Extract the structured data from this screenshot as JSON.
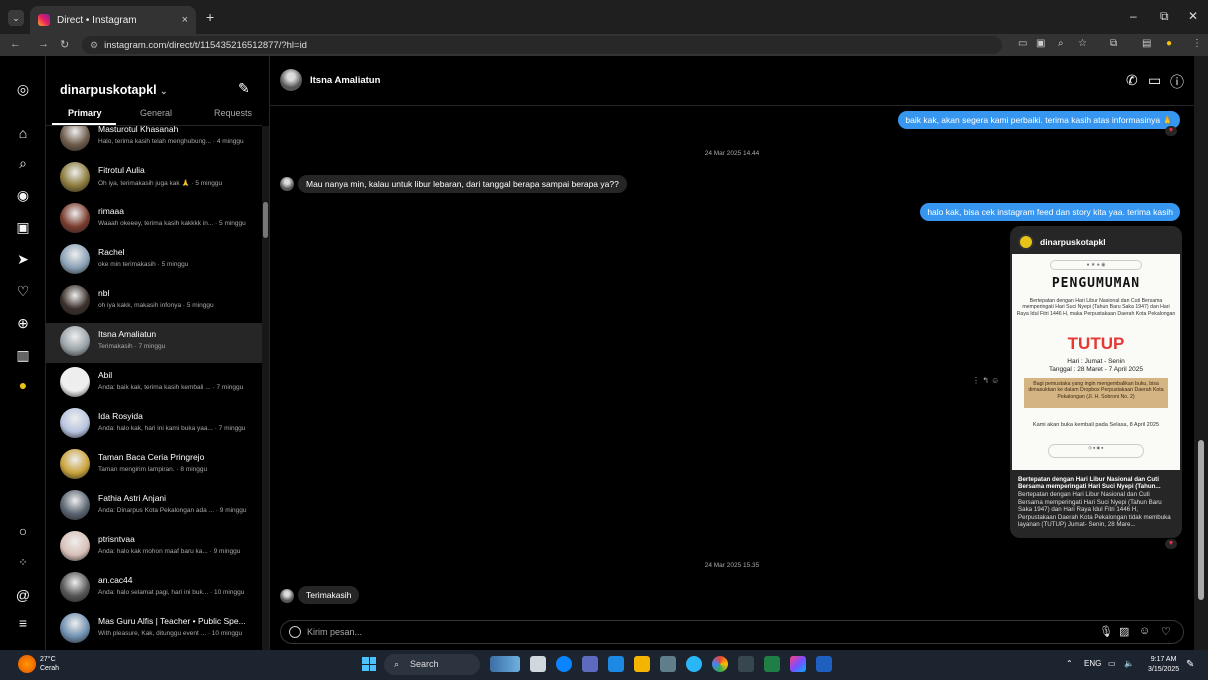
{
  "browser": {
    "tab_title": "Direct • Instagram",
    "tab_close": "×",
    "new_tab": "+",
    "url": "instagram.com/direct/t/115435216512877/?hl=id",
    "win_min": "–",
    "win_max": "⧉",
    "win_close": "✕"
  },
  "inbox": {
    "account": "dinarpuskotapkl",
    "tabs": [
      "Primary",
      "General",
      "Requests"
    ],
    "conversations": [
      {
        "name": "Masturotul Khasanah",
        "preview": "Halo, terima kasih telah menghubung... · 4 minggu",
        "color": "#6d5b4a"
      },
      {
        "name": "Fitrotul Aulia",
        "preview": "Oh iya, terimakasih juga kak 🙏 · 5 minggu",
        "color": "#8a7a3a"
      },
      {
        "name": "rimaaa",
        "preview": "Waaah okeeey, terima kasih kakkkk in... · 5 minggu",
        "color": "#7a3b2e"
      },
      {
        "name": "Rachel",
        "preview": "oke min terimakasih · 5 minggu",
        "color": "#8aa0b5"
      },
      {
        "name": "nbl",
        "preview": "oh iya kakk, makasih infonya · 5 minggu",
        "color": "#3a2f2a"
      },
      {
        "name": "Itsna Amaliatun",
        "preview": "Terimakasih · 7 minggu",
        "color": "#9aa3a8"
      },
      {
        "name": "Abil",
        "preview": "Anda: baik kak, terima kasih kembali ... · 7 minggu",
        "color": "#efefef"
      },
      {
        "name": "Ida Rosyida",
        "preview": "Anda: halo kak, hari ini kami buka yaa... · 7 minggu",
        "color": "#b8c4e0"
      },
      {
        "name": "Taman Baca Ceria Pringrejo",
        "preview": "Taman mengirim lampiran. · 8 minggu",
        "color": "#c9a23a"
      },
      {
        "name": "Fathia Astri Anjani",
        "preview": "Anda: Dinarpus Kota Pekalongan ada ... · 9 minggu",
        "color": "#5a6470"
      },
      {
        "name": "ptrisntvaa",
        "preview": "Anda: halo kak mohon maaf baru ka... · 9 minggu",
        "color": "#d8c0b8"
      },
      {
        "name": "an.cac44",
        "preview": "Anda: halo selamat pagi, hari ini buk... · 10 minggu",
        "color": "#555"
      },
      {
        "name": "Mas Guru Alfis | Teacher • Public Spe...",
        "preview": "With pleasure, Kak, ditunggu event ... · 10 minggu",
        "color": "#6f8fb0"
      }
    ]
  },
  "chat": {
    "contact_name": "Itsna Amaliatun",
    "msg_out_1": "baik kak, akan segera kami perbaiki. terima kasih atas informasinya 🙏",
    "date_1": "24 Mar 2025 14.44",
    "msg_in_1": "Mau nanya min, kalau untuk libur lebaran, dari tanggal berapa sampai berapa ya??",
    "msg_out_2": "halo kak, bisa cek instagram feed dan story kita yaa. terima kasih",
    "date_2": "24 Mar 2025 15.35",
    "msg_in_2": "Terimakasih",
    "composer_placeholder": "Kirim pesan...",
    "post": {
      "author": "dinarpuskotapkl",
      "heading": "PENGUMUMAN",
      "intro": "Bertepatan dengan Hari Libur Nasional dan Cuti Bersama memperingati Hari Suci Nyepi (Tahun Baru Saka 1947) dan Hari Raya Idul Fitri 1446 H, maka Perpustakaan Daerah Kota Pekalongan",
      "status": "TUTUP",
      "days": "Hari : Jumat - Senin",
      "dates": "Tanggal : 28 Maret - 7 April 2025",
      "box_text": "Bagi pemustaka yang ingin mengembalikan buku, bisa dimasukkan ke dalam Dropbox Perpustakaan Daerah Kota Pekalongan (Jl. H. Sobroni No. 2)",
      "reopen": "Kami akan buka kembali pada Selasa, 8 April 2025",
      "caption_title": "Bertepatan dengan Hari Libur Nasional dan Cuti Bersama memperingati Hari Suci Nyepi (Tahun...",
      "caption_body": "Bertepatan dengan Hari Libur Nasional dan Cuti Bersama memperingati Hari Suci Nyepi (Tahun Baru Saka 1947) dan Hari Raya Idul Fitri 1446 H, Perpustakaan Daerah Kota Pekalongan tidak membuka layanan (TUTUP) Jumat- Senin, 28 Mare..."
    }
  },
  "taskbar": {
    "temp": "27°C",
    "weather": "Cerah",
    "search": "Search",
    "lang": "ENG",
    "time": "9:17 AM",
    "date": "3/15/2025"
  }
}
